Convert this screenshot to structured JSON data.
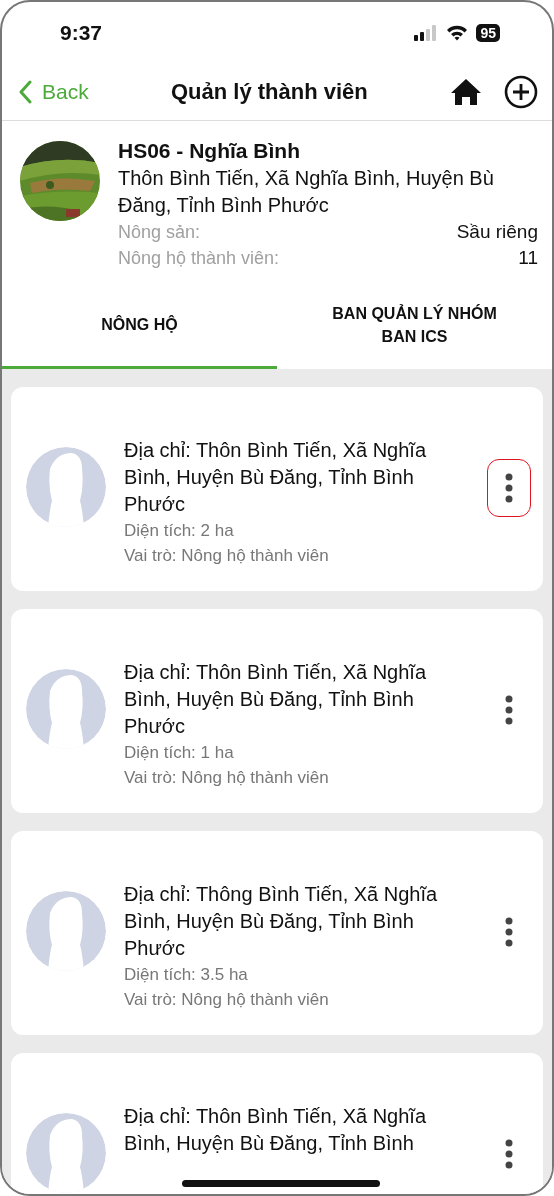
{
  "status_bar": {
    "time": "9:37",
    "battery": "95"
  },
  "nav": {
    "back": "Back",
    "title": "Quản lý thành viên"
  },
  "group": {
    "name": "HS06 - Nghĩa Bình",
    "address": "Thôn Bình Tiến, Xã Nghĩa Bình, Huyện Bù Đăng, Tỉnh Bình Phước",
    "details": [
      {
        "label": "Nông sản:",
        "value": "Sầu riêng"
      },
      {
        "label": "Nông hộ thành viên:",
        "value": "11"
      }
    ]
  },
  "tabs": [
    {
      "label": "NÔNG HỘ",
      "selected": true
    },
    {
      "label": "BAN QUẢN LÝ NHÓM BAN ICS",
      "selected": false
    }
  ],
  "members": [
    {
      "address": "Địa chỉ: Thôn Bình Tiến, Xã Nghĩa Bình, Huyện Bù Đăng, Tỉnh Bình Phước",
      "area": "Diện tích: 2 ha",
      "role": "Vai trò: Nông hộ thành viên",
      "highlighted": true
    },
    {
      "address": "Địa chỉ: Thôn Bình Tiến, Xã Nghĩa Bình, Huyện Bù Đăng, Tỉnh Bình Phước",
      "area": "Diện tích: 1 ha",
      "role": "Vai trò: Nông hộ thành viên",
      "highlighted": false
    },
    {
      "address": "Địa chỉ: Thông Bình Tiến, Xã Nghĩa Bình, Huyện Bù Đăng, Tỉnh Bình Phước",
      "area": "Diện tích: 3.5 ha",
      "role": "Vai trò: Nông hộ thành viên",
      "highlighted": false
    },
    {
      "address": "Địa chỉ: Thôn Bình Tiến, Xã Nghĩa Bình, Huyện Bù Đăng, Tỉnh Bình",
      "highlighted": false
    }
  ]
}
